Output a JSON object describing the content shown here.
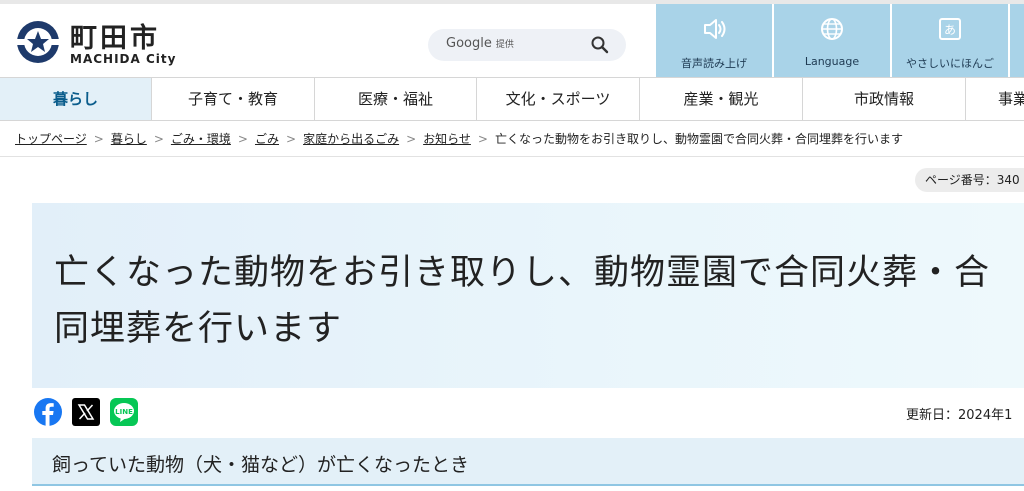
{
  "header": {
    "logo_jp": "町田市",
    "logo_en": "MACHIDA City",
    "search": {
      "brand": "Google",
      "brand_suffix": "提供"
    },
    "utilities": [
      {
        "label": "音声読み上げ",
        "icon": "speaker-icon"
      },
      {
        "label": "Language",
        "icon": "globe-icon"
      },
      {
        "label": "やさしいにほんご",
        "icon": "hiragana-a-icon",
        "glyph": "あ"
      }
    ]
  },
  "nav": {
    "items": [
      {
        "label": "暮らし",
        "active": true
      },
      {
        "label": "子育て・教育"
      },
      {
        "label": "医療・福祉"
      },
      {
        "label": "文化・スポーツ"
      },
      {
        "label": "産業・観光"
      },
      {
        "label": "市政情報"
      },
      {
        "label": "事業"
      }
    ]
  },
  "breadcrumb": {
    "items": [
      "トップページ",
      "暮らし",
      "ごみ・環境",
      "ごみ",
      "家庭から出るごみ",
      "お知らせ"
    ],
    "current": "亡くなった動物をお引き取りし、動物霊園で合同火葬・合同埋葬を行います",
    "separator": ">"
  },
  "page_number": "ページ番号：340",
  "title": "亡くなった動物をお引き取りし、動物霊園で合同火葬・合同埋葬を行います",
  "share": {
    "facebook": "facebook-icon",
    "x": "x-icon",
    "line": "line-icon",
    "line_text": "LINE"
  },
  "updated": "更新日：2024年1",
  "section_heading": "飼っていた動物（犬・猫など）が亡くなったとき",
  "colors": {
    "utility_bg": "#a9d3e8",
    "nav_active_bg": "#e3f0f8",
    "accent": "#0b5d8c",
    "facebook": "#1877f2",
    "line": "#06c755"
  }
}
